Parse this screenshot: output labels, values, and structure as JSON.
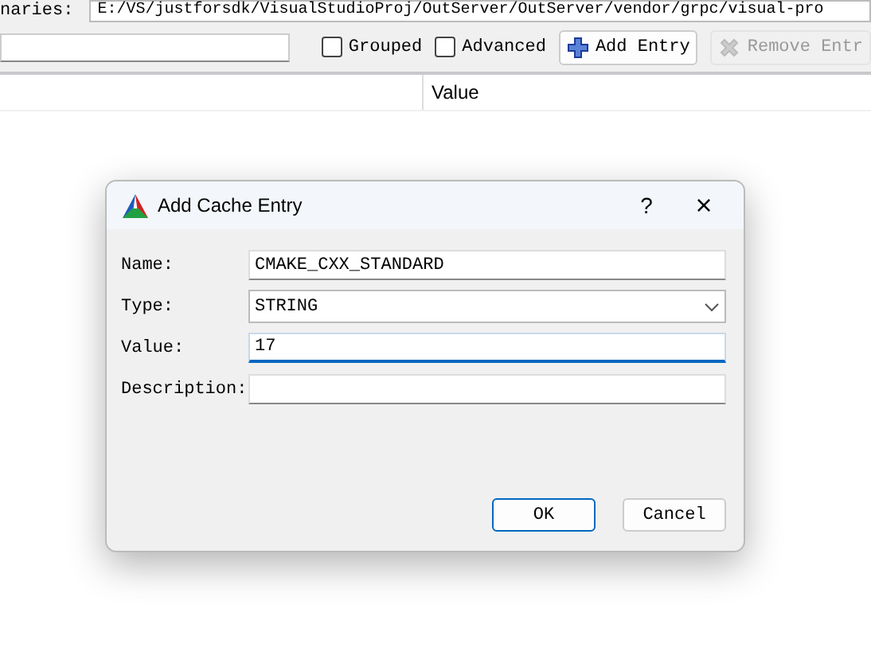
{
  "binaries_row": {
    "label": "naries:",
    "path": "E:/VS/justforsdk/VisualStudioProj/OutServer/OutServer/vendor/grpc/visual-pro"
  },
  "toolbar": {
    "checkboxes": [
      {
        "label": "Grouped",
        "checked": false
      },
      {
        "label": "Advanced",
        "checked": false
      }
    ],
    "buttons": [
      {
        "label": "Add Entry",
        "kind": "add",
        "disabled": false
      },
      {
        "label": "Remove Entr",
        "kind": "remove",
        "disabled": true
      }
    ]
  },
  "table": {
    "columns": [
      "Value"
    ]
  },
  "dialog": {
    "title": "Add Cache Entry",
    "help": "?",
    "close": "×",
    "fields": [
      {
        "label": "Name:",
        "kind": "text",
        "value": "CMAKE_CXX_STANDARD",
        "focused": false
      },
      {
        "label": "Type:",
        "kind": "select",
        "value": "STRING"
      },
      {
        "label": "Value:",
        "kind": "text",
        "value": "17",
        "focused": true
      },
      {
        "label": "Description:",
        "kind": "text",
        "focused": false
      }
    ],
    "buttons": [
      {
        "label": "OK",
        "default": true
      },
      {
        "label": "Cancel",
        "default": false
      }
    ]
  }
}
